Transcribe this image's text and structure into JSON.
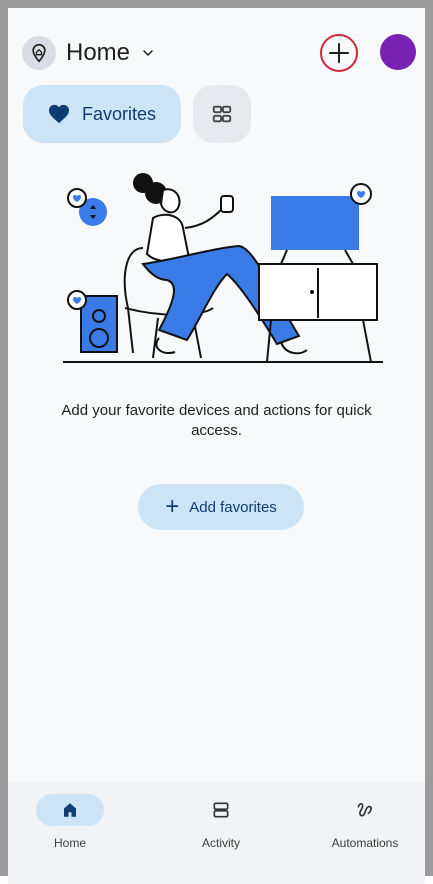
{
  "header": {
    "home_name": "Home",
    "icons": {
      "home": "location-home-icon",
      "chevron": "chevron-down-icon",
      "add": "plus-icon"
    },
    "colors": {
      "add_ring": "#d0263a",
      "avatar": "#7a22b4"
    }
  },
  "chips": {
    "favorites_label": "Favorites",
    "favorites_icon": "heart-icon",
    "grid_icon": "grid-icon",
    "accent": "#cde4f7"
  },
  "empty_state": {
    "message": "Add your favorite devices and actions for quick access.",
    "add_button_label": "Add favorites"
  },
  "bottom_nav": {
    "items": [
      {
        "label": "Home",
        "icon": "home-icon",
        "active": true
      },
      {
        "label": "Activity",
        "icon": "activity-icon",
        "active": false
      },
      {
        "label": "Automations",
        "icon": "automations-icon",
        "active": false
      }
    ]
  }
}
